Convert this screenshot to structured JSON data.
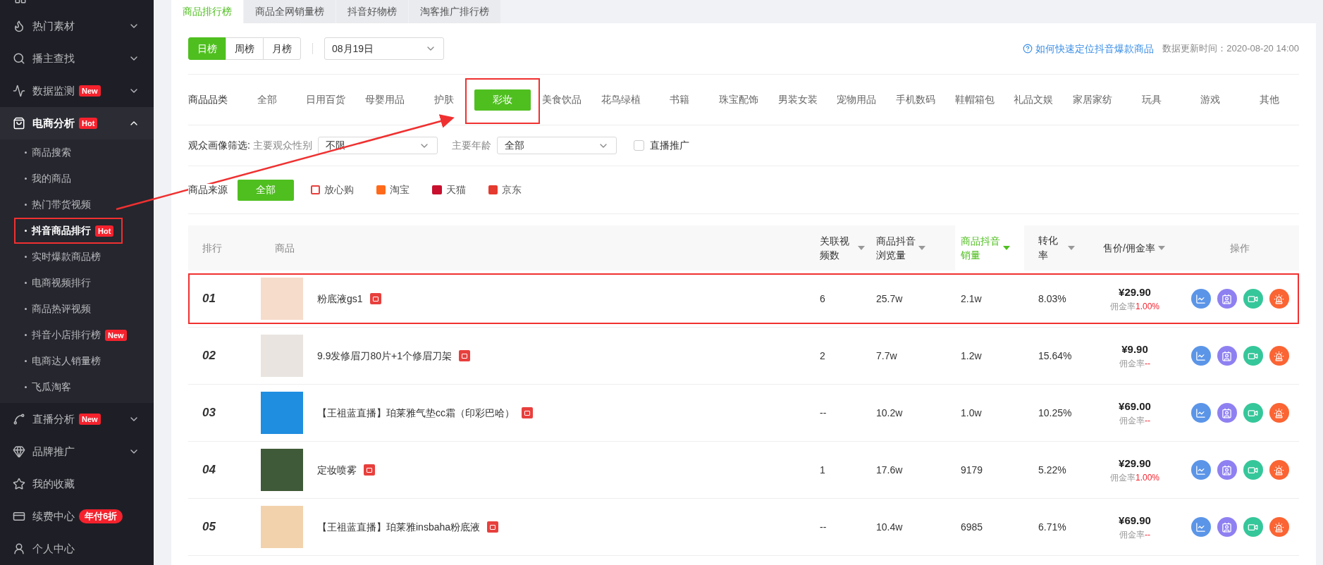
{
  "sidebar": {
    "items": [
      {
        "label": "热门素材",
        "kind": "group",
        "expanded": false
      },
      {
        "label": "播主查找",
        "kind": "group",
        "expanded": false
      },
      {
        "label": "数据监测",
        "kind": "group",
        "expanded": false,
        "badge": "New"
      },
      {
        "label": "电商分析",
        "kind": "group",
        "expanded": true,
        "badge": "Hot",
        "children": [
          {
            "label": "商品搜索",
            "selected": false,
            "annotated": false
          },
          {
            "label": "我的商品",
            "selected": false,
            "annotated": false
          },
          {
            "label": "热门带货视频",
            "selected": false,
            "annotated": false
          },
          {
            "label": "抖音商品排行",
            "selected": true,
            "annotated": true,
            "badge": "Hot"
          },
          {
            "label": "实时爆款商品榜",
            "selected": false,
            "annotated": false
          },
          {
            "label": "电商视频排行",
            "selected": false,
            "annotated": false
          },
          {
            "label": "商品热评视频",
            "selected": false,
            "annotated": false
          },
          {
            "label": "抖音小店排行榜",
            "selected": false,
            "annotated": false,
            "badge": "New"
          },
          {
            "label": "电商达人销量榜",
            "selected": false,
            "annotated": false
          },
          {
            "label": "飞瓜淘客",
            "selected": false,
            "annotated": false
          }
        ]
      },
      {
        "label": "直播分析",
        "kind": "group",
        "expanded": false,
        "badge": "New"
      },
      {
        "label": "品牌推广",
        "kind": "group",
        "expanded": false
      },
      {
        "label": "我的收藏",
        "kind": "link"
      },
      {
        "label": "续费中心",
        "kind": "link",
        "badge": "年付6折"
      },
      {
        "label": "个人中心",
        "kind": "link"
      }
    ]
  },
  "tabs": [
    {
      "label": "商品排行榜",
      "selected": true
    },
    {
      "label": "商品全网销量榜",
      "selected": false
    },
    {
      "label": "抖音好物榜",
      "selected": false
    },
    {
      "label": "淘客推广排行榜",
      "selected": false
    }
  ],
  "period": [
    {
      "label": "日榜",
      "selected": true
    },
    {
      "label": "周榜",
      "selected": false
    },
    {
      "label": "月榜",
      "selected": false
    }
  ],
  "date": {
    "value": "08月19日"
  },
  "help_link": "如何快速定位抖音爆款商品",
  "update_time": "数据更新时间：2020-08-20 14:00",
  "category": {
    "label": "商品品类",
    "options": [
      {
        "label": "全部",
        "selected": false,
        "annotated": false
      },
      {
        "label": "日用百货",
        "selected": false,
        "annotated": false
      },
      {
        "label": "母婴用品",
        "selected": false,
        "annotated": false
      },
      {
        "label": "护肤",
        "selected": false,
        "annotated": false
      },
      {
        "label": "彩妆",
        "selected": true,
        "annotated": true
      },
      {
        "label": "美食饮品",
        "selected": false,
        "annotated": false
      },
      {
        "label": "花鸟绿植",
        "selected": false,
        "annotated": false
      },
      {
        "label": "书籍",
        "selected": false,
        "annotated": false
      },
      {
        "label": "珠宝配饰",
        "selected": false,
        "annotated": false
      },
      {
        "label": "男装女装",
        "selected": false,
        "annotated": false
      },
      {
        "label": "宠物用品",
        "selected": false,
        "annotated": false
      },
      {
        "label": "手机数码",
        "selected": false,
        "annotated": false
      },
      {
        "label": "鞋帽箱包",
        "selected": false,
        "annotated": false
      },
      {
        "label": "礼品文娱",
        "selected": false,
        "annotated": false
      },
      {
        "label": "家居家纺",
        "selected": false,
        "annotated": false
      },
      {
        "label": "玩具",
        "selected": false,
        "annotated": false
      },
      {
        "label": "游戏",
        "selected": false,
        "annotated": false
      },
      {
        "label": "其他",
        "selected": false,
        "annotated": false
      }
    ]
  },
  "audience": {
    "label": "观众画像筛选:",
    "gender_label": "主要观众性别",
    "gender_value": "不限",
    "age_label": "主要年龄",
    "age_value": "全部",
    "live_promo": {
      "label": "直播推广",
      "checked": false
    }
  },
  "source": {
    "label": "商品来源",
    "options": [
      {
        "label": "全部",
        "selected": true,
        "kind": "all"
      },
      {
        "label": "放心购",
        "selected": false,
        "kind": "bag"
      },
      {
        "label": "淘宝",
        "selected": false,
        "kind": "taobao"
      },
      {
        "label": "天猫",
        "selected": false,
        "kind": "tmall"
      },
      {
        "label": "京东",
        "selected": false,
        "kind": "jd"
      }
    ]
  },
  "table": {
    "columns": [
      {
        "label": "排行",
        "sortable": false,
        "sorted": false
      },
      {
        "label": "商品",
        "sortable": false,
        "sorted": false
      },
      {
        "label": "关联视频数",
        "sortable": true,
        "sorted": false
      },
      {
        "label": "商品抖音浏览量",
        "sortable": true,
        "sorted": false
      },
      {
        "label": "商品抖音销量",
        "sortable": true,
        "sorted": true
      },
      {
        "label": "转化率",
        "sortable": true,
        "sorted": false
      },
      {
        "label": "售价/佣金率",
        "sortable": true,
        "sorted": false
      },
      {
        "label": "操作",
        "sortable": false,
        "sorted": false
      }
    ],
    "rows": [
      {
        "rank": "01",
        "title": "粉底液gs1",
        "related_videos": "6",
        "views": "25.7w",
        "sales": "2.1w",
        "conversion": "8.03%",
        "price": "¥29.90",
        "commission_label": "佣金率",
        "commission": "1.00%",
        "annotated": true
      },
      {
        "rank": "02",
        "title": "9.9发修眉刀80片+1个修眉刀架",
        "related_videos": "2",
        "views": "7.7w",
        "sales": "1.2w",
        "conversion": "15.64%",
        "price": "¥9.90",
        "commission_label": "佣金率",
        "commission": "--",
        "annotated": false
      },
      {
        "rank": "03",
        "title": "【王祖蓝直播】珀莱雅气垫cc霜（印彩巴哈）",
        "related_videos": "--",
        "views": "10.2w",
        "sales": "1.0w",
        "conversion": "10.25%",
        "price": "¥69.00",
        "commission_label": "佣金率",
        "commission": "--",
        "annotated": false
      },
      {
        "rank": "04",
        "title": "定妆喷雾",
        "related_videos": "1",
        "views": "17.6w",
        "sales": "9179",
        "conversion": "5.22%",
        "price": "¥29.90",
        "commission_label": "佣金率",
        "commission": "1.00%",
        "annotated": false
      },
      {
        "rank": "05",
        "title": "【王祖蓝直播】珀莱雅insbaha粉底液",
        "related_videos": "--",
        "views": "10.4w",
        "sales": "6985",
        "conversion": "6.71%",
        "price": "¥69.90",
        "commission_label": "佣金率",
        "commission": "--",
        "annotated": false
      }
    ]
  }
}
